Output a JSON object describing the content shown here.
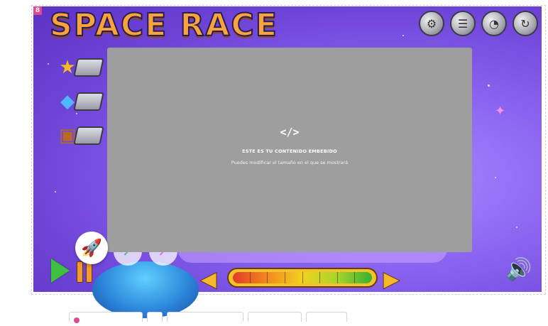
{
  "game": {
    "title": "SPACE RACE",
    "corner_badge": "8"
  },
  "top_buttons": [
    {
      "name": "settings-icon",
      "glyph": "⚙"
    },
    {
      "name": "menu-list-icon",
      "glyph": "☰"
    },
    {
      "name": "help-icon",
      "glyph": "◔"
    },
    {
      "name": "restart-icon",
      "glyph": "↻"
    }
  ],
  "hud": [
    {
      "name": "star-icon",
      "glyph": "★",
      "color": "#f5b82a"
    },
    {
      "name": "diamond-icon",
      "glyph": "◆",
      "color": "#4fb8ff"
    },
    {
      "name": "treasure-chest-icon",
      "glyph": "▣",
      "color": "#b86a22"
    }
  ],
  "embed": {
    "icon": "</>",
    "title": "ESTE ES TU CONTENIDO EMBEBIDO",
    "subtitle": "Puedes modificar el tamaño en el que se mostrará"
  },
  "controls": {
    "rocket_glyph": "🚀",
    "progress_segments": 8,
    "colors": {
      "accent_orange": "#f7a53a",
      "play_green": "#3fbf3f",
      "embed_gray": "#9e9e9e"
    }
  }
}
